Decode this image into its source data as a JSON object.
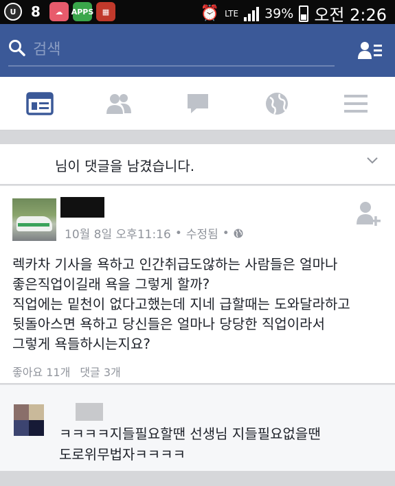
{
  "status_bar": {
    "apps_label": "APPS",
    "battery": "39%",
    "time": "오전 2:26",
    "network": "LTE"
  },
  "search": {
    "placeholder": "검색"
  },
  "notification": {
    "text": "님이 댓글을 남겼습니다."
  },
  "post": {
    "meta_date": "10월 8일 오후11:16",
    "meta_edited": "수정됨",
    "body_lines": [
      "렉카차 기사을 욕하고 인간취급도않하는 사람들은 얼마나",
      "좋은직업이길래  욕을 그렇게 할까?",
      "직업에는 밑천이 없다고했는데 지네 급할때는 도와달라하고",
      "뒷돌아스면 욕하고  당신들은 얼마나 당당한 직업이라서",
      "그렇게 욕들하시는지요?"
    ],
    "likes": "좋아요 11개",
    "comments_count": "댓글 3개"
  },
  "comment": {
    "lines": [
      "ㅋㅋㅋㅋ지들필요할땐 선생님 지들필요없을땐",
      "도로위무법자ㅋㅋㅋㅋ"
    ]
  },
  "colors": {
    "brand": "#3b5998",
    "active_tab": "#3b5998",
    "inactive_tab": "#bec2c9"
  }
}
